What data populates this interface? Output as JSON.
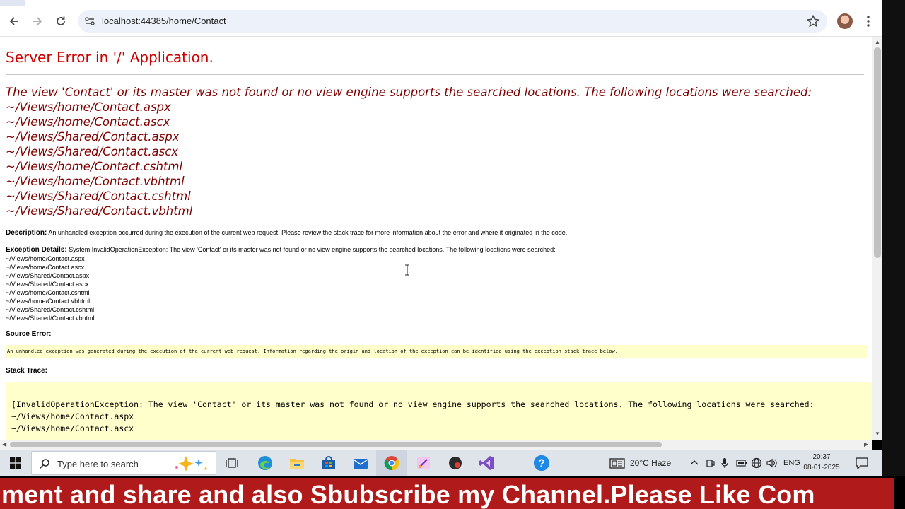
{
  "browser": {
    "url": "localhost:44385/home/Contact"
  },
  "page": {
    "title": "Server Error in '/' Application.",
    "view_message": "The view 'Contact' or its master was not found or no view engine supports the searched locations. The following locations were searched:",
    "locations": [
      "~/Views/home/Contact.aspx",
      "~/Views/home/Contact.ascx",
      "~/Views/Shared/Contact.aspx",
      "~/Views/Shared/Contact.ascx",
      "~/Views/home/Contact.cshtml",
      "~/Views/home/Contact.vbhtml",
      "~/Views/Shared/Contact.cshtml",
      "~/Views/Shared/Contact.vbhtml"
    ],
    "description_label": "Description:",
    "description_text": "An unhandled exception occurred during the execution of the current web request. Please review the stack trace for more information about the error and where it originated in the code.",
    "exception_label": "Exception Details:",
    "exception_text": "System.InvalidOperationException: The view 'Contact' or its master was not found or no view engine supports the searched locations. The following locations were searched:",
    "source_error_label": "Source Error:",
    "source_error_text": "An unhandled exception was generated during the execution of the current web request. Information regarding the origin and location of the exception can be identified using the exception stack trace below.",
    "stack_trace_label": "Stack Trace:",
    "stack_lines": [
      "[InvalidOperationException: The view 'Contact' or its master was not found or no view engine supports the searched locations. The following locations were searched:",
      "~/Views/home/Contact.aspx",
      "~/Views/home/Contact.ascx"
    ]
  },
  "taskbar": {
    "search_placeholder": "Type here to search",
    "weather": "20°C  Haze",
    "language": "ENG",
    "time": "20:37",
    "date": "08-01-2025"
  },
  "banner": {
    "text": "ment and share and also Sbubscribe my Channel.Please Like Com"
  },
  "colors": {
    "error_title": "#cc0000",
    "view_message": "#800000",
    "code_box": "#ffffcc",
    "banner_bg": "#b11a1a"
  }
}
